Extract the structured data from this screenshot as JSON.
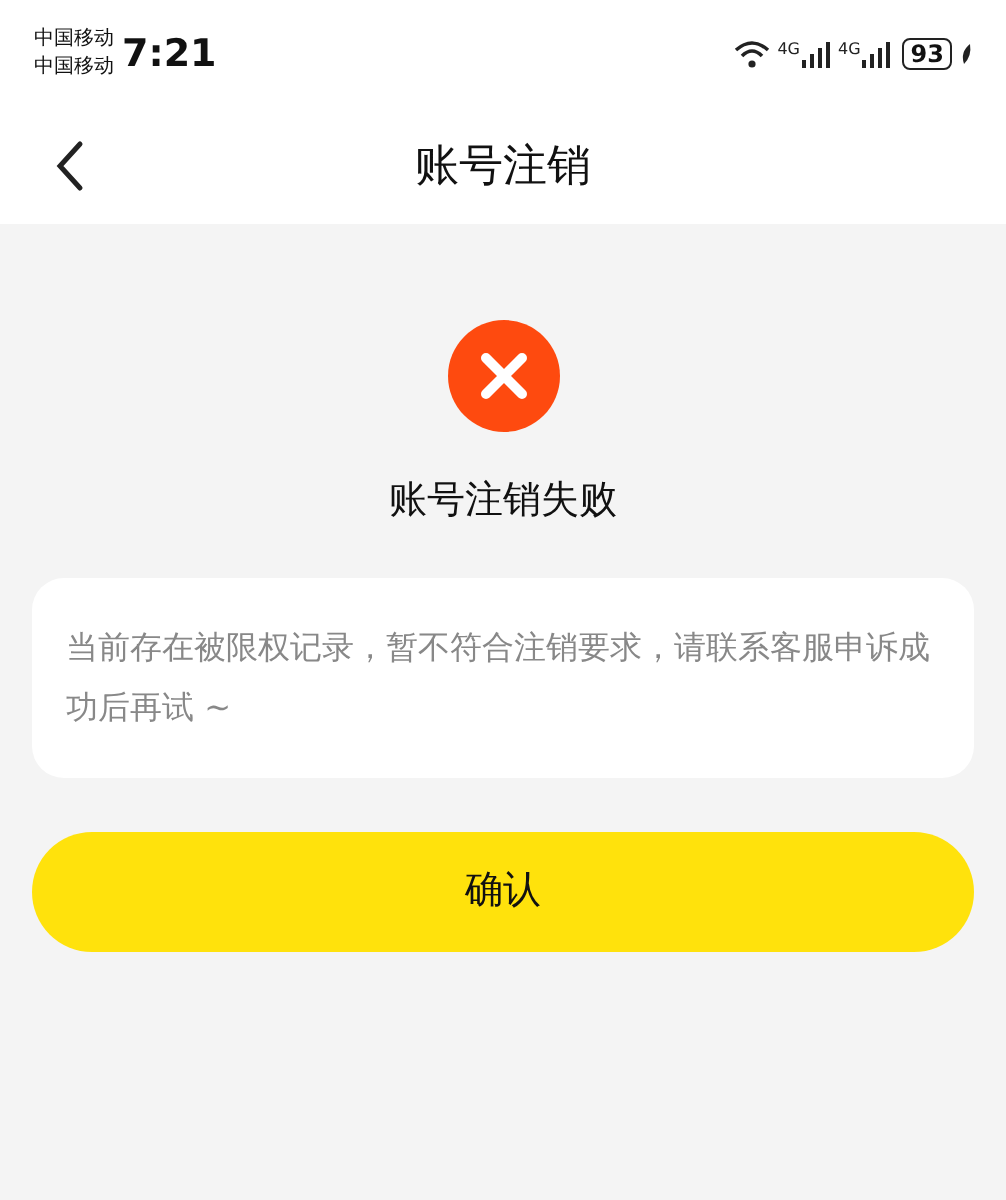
{
  "status_bar": {
    "carriers": [
      "中国移动",
      "中国移动"
    ],
    "time": "7:21",
    "networks": [
      "4G",
      "4G"
    ],
    "battery": "93"
  },
  "header": {
    "title": "账号注销"
  },
  "result": {
    "kind": "failure",
    "title": "账号注销失败",
    "message": "当前存在被限权记录，暂不符合注销要求，请联系客服申诉成功后再试 ~"
  },
  "buttons": [
    "确认"
  ]
}
